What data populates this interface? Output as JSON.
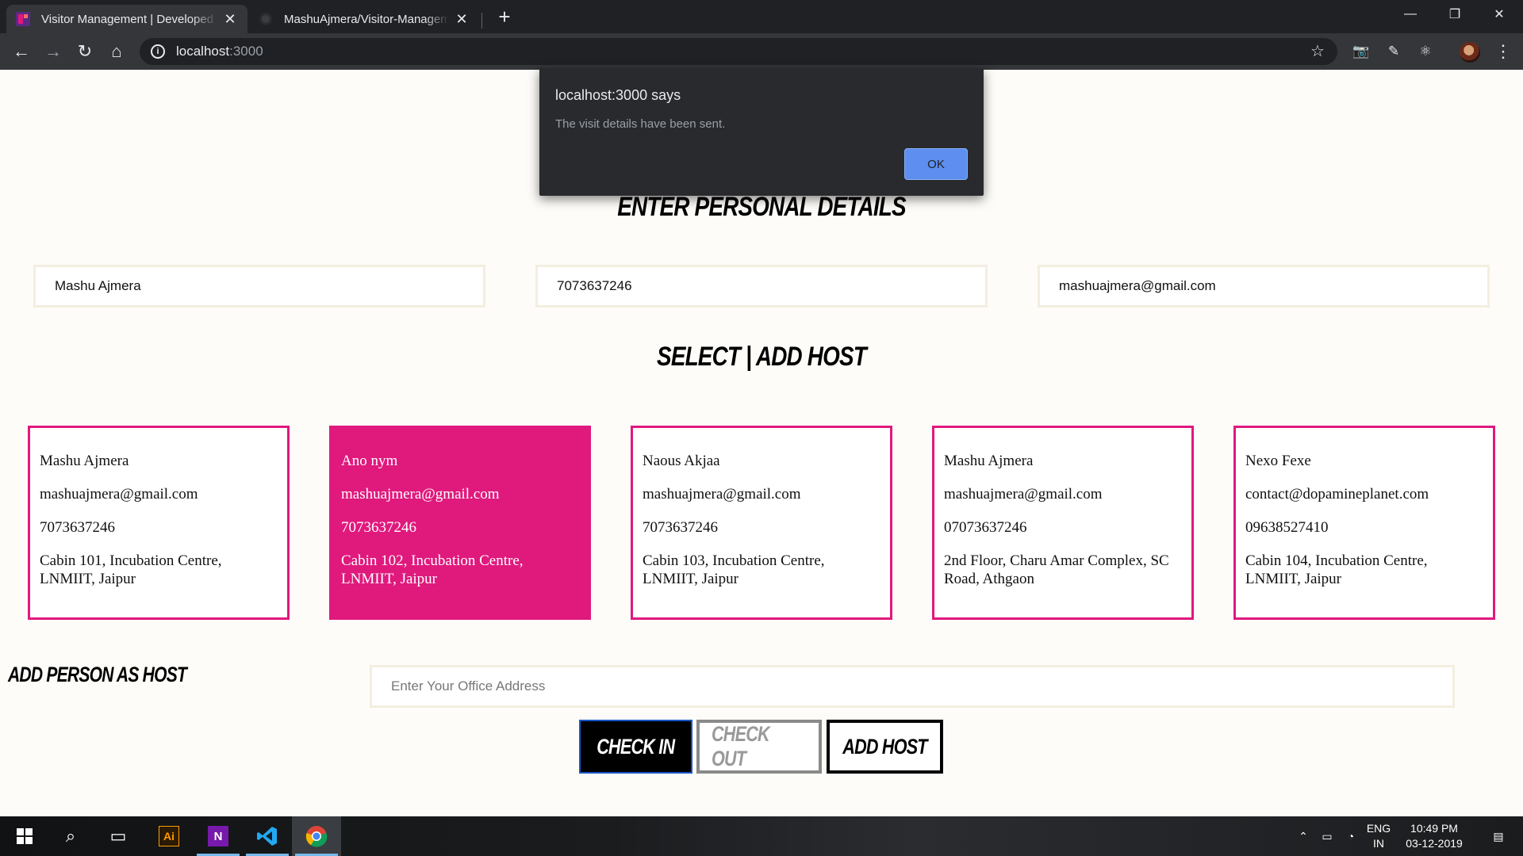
{
  "browser": {
    "tabs": [
      {
        "title": "Visitor Management | Developed by Mashu Ajmera",
        "active": true
      },
      {
        "title": "MashuAjmera/Visitor-Management",
        "active": false
      }
    ],
    "url_host": "localhost",
    "url_port": ":3000"
  },
  "alert": {
    "title": "localhost:3000 says",
    "message": "The visit details have been sent.",
    "ok_label": "OK"
  },
  "page": {
    "personal_heading": "ENTER PERSONAL DETAILS",
    "fields": {
      "name": "Mashu Ajmera",
      "phone": "7073637246",
      "email": "mashuajmera@gmail.com"
    },
    "host_heading": "SELECT | ADD HOST",
    "hosts": [
      {
        "name": "Mashu Ajmera",
        "email": "mashuajmera@gmail.com",
        "phone": "7073637246",
        "address": "Cabin 101, Incubation Centre, LNMIIT, Jaipur",
        "selected": false
      },
      {
        "name": "Ano nym",
        "email": "mashuajmera@gmail.com",
        "phone": "7073637246",
        "address": "Cabin 102, Incubation Centre, LNMIIT, Jaipur",
        "selected": true
      },
      {
        "name": "Naous Akjaa",
        "email": "mashuajmera@gmail.com",
        "phone": "7073637246",
        "address": "Cabin 103, Incubation Centre, LNMIIT, Jaipur",
        "selected": false
      },
      {
        "name": "Mashu Ajmera",
        "email": "mashuajmera@gmail.com",
        "phone": "07073637246",
        "address": "2nd Floor, Charu Amar Complex, SC Road, Athgaon",
        "selected": false
      },
      {
        "name": "Nexo Fexe",
        "email": "contact@dopamineplanet.com",
        "phone": "09638527410",
        "address": "Cabin 104, Incubation Centre, LNMIIT, Jaipur",
        "selected": false
      }
    ],
    "add_person_label": "ADD PERSON AS HOST",
    "office_placeholder": "Enter Your Office Address",
    "buttons": {
      "checkin": "CHECK IN",
      "checkout": "CHECK OUT",
      "addhost": "ADD HOST"
    }
  },
  "taskbar": {
    "lang_top": "ENG",
    "lang_bottom": "IN",
    "time": "10:49 PM",
    "date": "03-12-2019"
  },
  "colors": {
    "accent_pink": "#e0197d",
    "dialog_ok": "#5d8ef0"
  }
}
